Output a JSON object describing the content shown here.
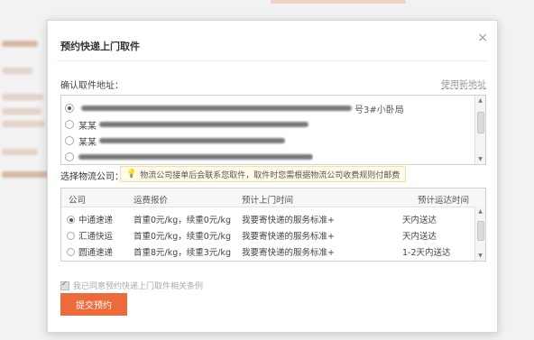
{
  "modal": {
    "title": "预约快递上门取件",
    "close_icon": "close-icon"
  },
  "address": {
    "label": "确认取件地址：",
    "new_link": "使用新地址",
    "items": [
      {
        "name": "",
        "tail": "号3#小卧局",
        "selected": true
      },
      {
        "name": "某某",
        "tail": "",
        "selected": false
      },
      {
        "name": "某某",
        "tail": "",
        "selected": false
      }
    ]
  },
  "logistics": {
    "label": "选择物流公司：",
    "notice": "物流公司接单后会联系您取件，取件时您需根据物流公司收费规则付邮费",
    "notice_icon": "lightbulb-icon",
    "headers": [
      "公司",
      "运费报价",
      "预计上门时间",
      "预计运达时间"
    ],
    "rows": [
      {
        "company": "中通速递",
        "price": "首重0元/kg，续重0元/kg",
        "pickup": "我要寄快递的服务标准+",
        "arrival": "天内送达",
        "selected": true
      },
      {
        "company": "汇通快运",
        "price": "首重0元/kg，续重0元/kg",
        "pickup": "我要寄快递的服务标准+",
        "arrival": "天内送达",
        "selected": false
      },
      {
        "company": "圆通速递",
        "price": "首重8元/kg，续重3元/kg",
        "pickup": "我要寄快递的服务标准+",
        "arrival": "1-2天内送达",
        "selected": false
      }
    ]
  },
  "agreement": {
    "text": "我已同意预约快递上门取件相关条例",
    "checked": true
  },
  "submit": {
    "label": "提交预约"
  },
  "colors": {
    "accent": "#ef6a3a",
    "notice_bg": "#fffbe8"
  }
}
